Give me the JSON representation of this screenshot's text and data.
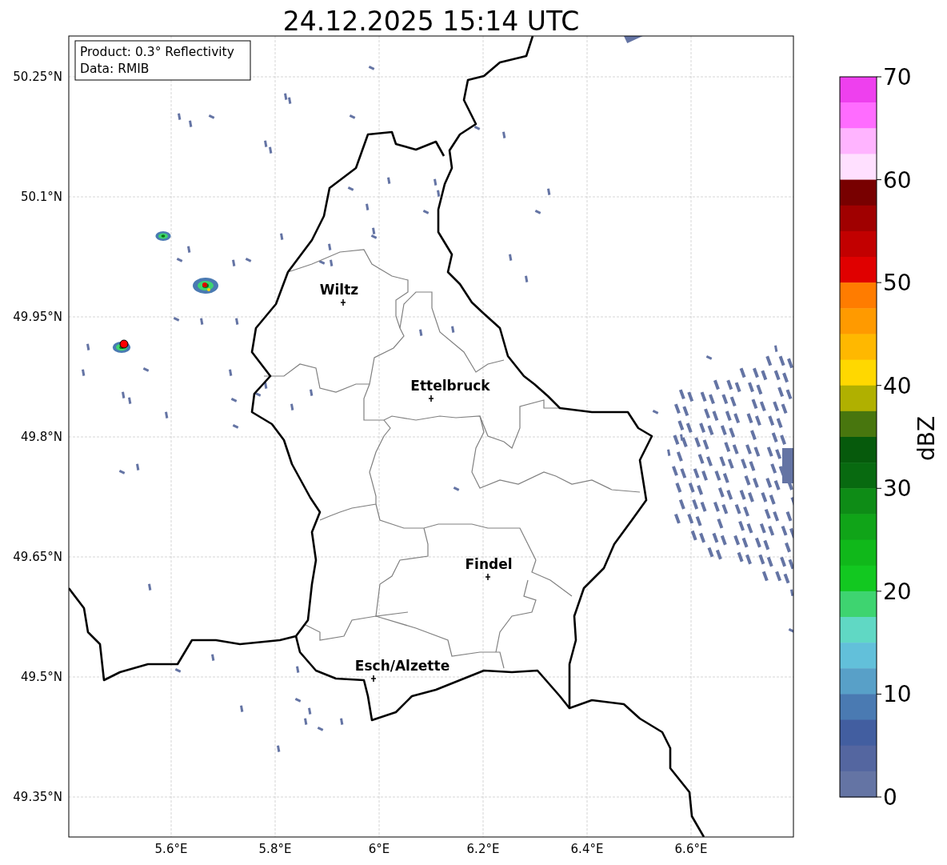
{
  "title": "24.12.2025 15:14 UTC",
  "map": {
    "info_box": [
      "Product: 0.3° Reflectivity",
      "Data: RMIB"
    ],
    "cities": [
      "Wiltz",
      "Ettelbruck",
      "Findel",
      "Esch/Alzette"
    ],
    "y_ticks": [
      "50.25°N",
      "50.1°N",
      "49.95°N",
      "49.8°N",
      "49.65°N",
      "49.5°N",
      "49.35°N"
    ],
    "x_ticks": [
      "5.6°E",
      "5.8°E",
      "6°E",
      "6.2°E",
      "6.4°E",
      "6.6°E"
    ]
  },
  "colorbar": {
    "label": "dBZ",
    "ticks": [
      "70",
      "60",
      "50",
      "40",
      "30",
      "20",
      "10",
      "0"
    ],
    "bands": [
      {
        "color": "#ee40ee"
      },
      {
        "color": "#ff6cff"
      },
      {
        "color": "#ffb4ff"
      },
      {
        "color": "#ffe0ff"
      },
      {
        "color": "#780000"
      },
      {
        "color": "#a00000"
      },
      {
        "color": "#c20000"
      },
      {
        "color": "#e00000"
      },
      {
        "color": "#ff7c00"
      },
      {
        "color": "#ff9a00"
      },
      {
        "color": "#ffb800"
      },
      {
        "color": "#ffd800"
      },
      {
        "color": "#b0b000"
      },
      {
        "color": "#48760e"
      },
      {
        "color": "#065a0c"
      },
      {
        "color": "#086a10"
      },
      {
        "color": "#0e8c16"
      },
      {
        "color": "#10a418"
      },
      {
        "color": "#10b81a"
      },
      {
        "color": "#12c820"
      },
      {
        "color": "#3ed470"
      },
      {
        "color": "#60d8c4"
      },
      {
        "color": "#62c0da"
      },
      {
        "color": "#58a0c8"
      },
      {
        "color": "#4a7ab2"
      },
      {
        "color": "#425ea0"
      },
      {
        "color": "#5466a0"
      },
      {
        "color": "#6474a4"
      }
    ]
  }
}
